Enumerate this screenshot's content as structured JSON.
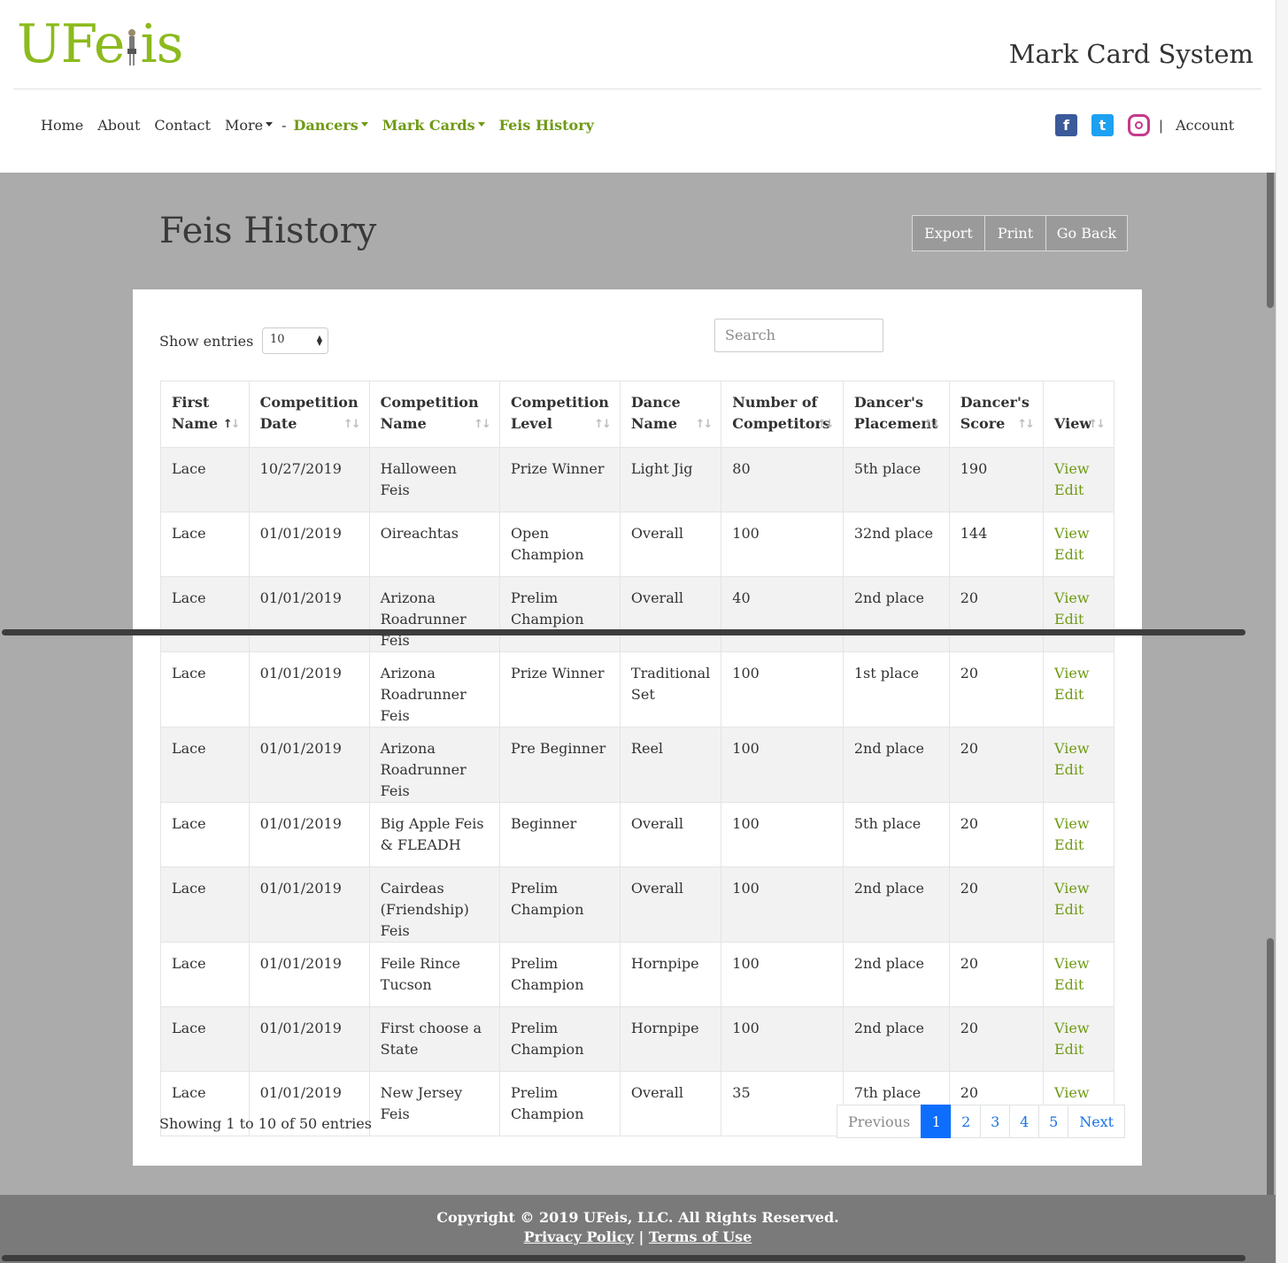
{
  "header": {
    "logo_text_pre": "UFe",
    "logo_text_post": "is",
    "system_title": "Mark Card System"
  },
  "nav": {
    "home": "Home",
    "about": "About",
    "contact": "Contact",
    "more": "More",
    "dash": "-",
    "dancers": "Dancers",
    "mark_cards": "Mark Cards",
    "feis_history": "Feis History",
    "pipe": "|",
    "account": "Account"
  },
  "social": {
    "facebook": "f",
    "twitter": "t"
  },
  "page": {
    "title": "Feis History",
    "export": "Export",
    "print": "Print",
    "go_back": "Go Back"
  },
  "controls": {
    "show_entries_label": "Show entries",
    "entries_value": "10",
    "search_placeholder": "Search"
  },
  "table": {
    "headers": [
      [
        "First",
        "Name"
      ],
      [
        "Competition",
        "Date"
      ],
      [
        "Competition",
        "Name"
      ],
      [
        "Competition",
        "Level"
      ],
      [
        "Dance",
        "Name"
      ],
      [
        "Number of",
        "Competitors"
      ],
      [
        "Dancer's",
        "Placement"
      ],
      [
        "Dancer's",
        "Score"
      ],
      [
        "View",
        ""
      ]
    ],
    "rows": [
      {
        "first": "Lace",
        "date": "10/27/2019",
        "name": "Halloween Feis",
        "level": "Prize Winner",
        "dance": "Light Jig",
        "competitors": "80",
        "placement": "5th place",
        "score": "190"
      },
      {
        "first": "Lace",
        "date": "01/01/2019",
        "name": "Oireachtas",
        "level": "Open Champion",
        "dance": "Overall",
        "competitors": "100",
        "placement": "32nd place",
        "score": "144"
      },
      {
        "first": "Lace",
        "date": "01/01/2019",
        "name": "Arizona Roadrunner Feis",
        "level": "Prelim Champion",
        "dance": "Overall",
        "competitors": "40",
        "placement": "2nd place",
        "score": "20"
      },
      {
        "first": "Lace",
        "date": "01/01/2019",
        "name": "Arizona Roadrunner Feis",
        "level": "Prize Winner",
        "dance": "Traditional Set",
        "competitors": "100",
        "placement": "1st place",
        "score": "20"
      },
      {
        "first": "Lace",
        "date": "01/01/2019",
        "name": "Arizona Roadrunner Feis",
        "level": "Pre Beginner",
        "dance": "Reel",
        "competitors": "100",
        "placement": "2nd place",
        "score": "20"
      },
      {
        "first": "Lace",
        "date": "01/01/2019",
        "name": "Big Apple Feis & FLEADH",
        "level": "Beginner",
        "dance": "Overall",
        "competitors": "100",
        "placement": "5th place",
        "score": "20"
      },
      {
        "first": "Lace",
        "date": "01/01/2019",
        "name": "Cairdeas (Friendship) Feis",
        "level": "Prelim Champion",
        "dance": "Overall",
        "competitors": "100",
        "placement": "2nd place",
        "score": "20"
      },
      {
        "first": "Lace",
        "date": "01/01/2019",
        "name": "Feile Rince Tucson",
        "level": "Prelim Champion",
        "dance": "Hornpipe",
        "competitors": "100",
        "placement": "2nd place",
        "score": "20"
      },
      {
        "first": "Lace",
        "date": "01/01/2019",
        "name": "First choose a State",
        "level": "Prelim Champion",
        "dance": "Hornpipe",
        "competitors": "100",
        "placement": "2nd place",
        "score": "20"
      },
      {
        "first": "Lace",
        "date": "01/01/2019",
        "name": "New Jersey Feis",
        "level": "Prelim Champion",
        "dance": "Overall",
        "competitors": "35",
        "placement": "7th place",
        "score": "20"
      }
    ],
    "view_label": "View",
    "edit_label": "Edit"
  },
  "pagination": {
    "info": "Showing 1 to 10 of 50 entries",
    "previous": "Previous",
    "pages": [
      "1",
      "2",
      "3",
      "4",
      "5"
    ],
    "next": "Next",
    "active_page": "1"
  },
  "footer": {
    "copyright": "Copyright © 2019 UFeis, LLC. All Rights Reserved.",
    "privacy": "Privacy Policy",
    "separator": "|",
    "terms": "Terms of Use"
  }
}
